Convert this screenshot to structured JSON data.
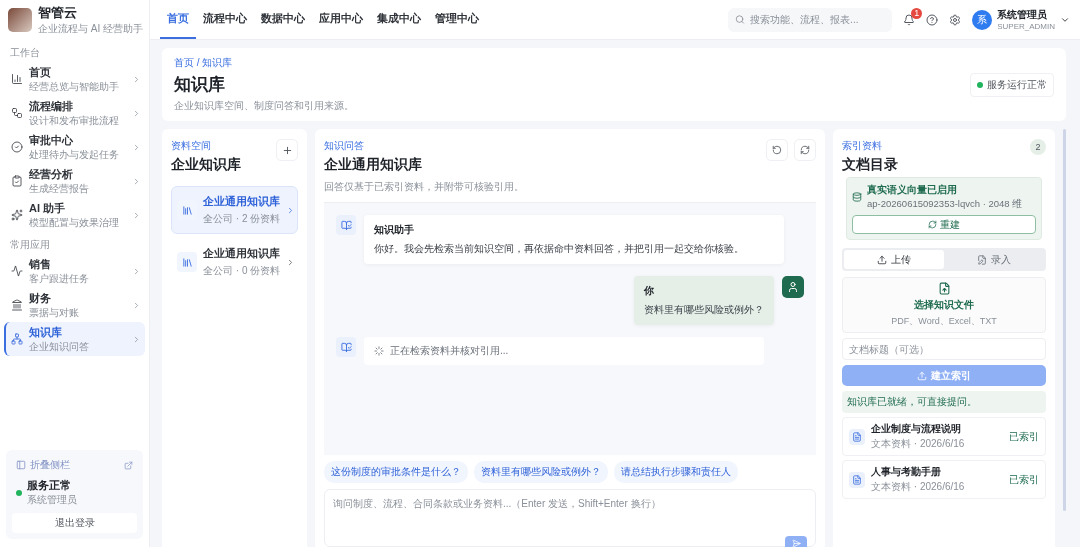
{
  "brand": {
    "name": "智管云",
    "subtitle": "企业流程与 AI 经营助手"
  },
  "sidebar": {
    "sections": [
      {
        "title": "工作台",
        "items": [
          {
            "label": "首页",
            "desc": "经营总览与智能助手",
            "selected": false
          },
          {
            "label": "流程编排",
            "desc": "设计和发布审批流程",
            "selected": false
          },
          {
            "label": "审批中心",
            "desc": "处理待办与发起任务",
            "selected": false
          },
          {
            "label": "经营分析",
            "desc": "生成经营报告",
            "selected": false
          },
          {
            "label": "AI 助手",
            "desc": "模型配置与效果治理",
            "selected": false
          }
        ]
      },
      {
        "title": "常用应用",
        "items": [
          {
            "label": "销售",
            "desc": "客户跟进任务",
            "selected": false
          },
          {
            "label": "财务",
            "desc": "票据与对账",
            "selected": false
          },
          {
            "label": "知识库",
            "desc": "企业知识问答",
            "selected": true
          }
        ]
      }
    ],
    "footer": {
      "collapse": "折叠侧栏",
      "status": "服务正常",
      "role": "系统管理员",
      "logout": "退出登录"
    }
  },
  "topnav": {
    "tabs": [
      {
        "label": "首页",
        "selected": true
      },
      {
        "label": "流程中心",
        "selected": false
      },
      {
        "label": "数据中心",
        "selected": false
      },
      {
        "label": "应用中心",
        "selected": false
      },
      {
        "label": "集成中心",
        "selected": false
      },
      {
        "label": "管理中心",
        "selected": false
      }
    ],
    "search": {
      "placeholder": "搜索功能、流程、报表..."
    },
    "notifications": "1",
    "user": {
      "avatar": "系",
      "name": "系统管理员",
      "role": "SUPER_ADMIN"
    }
  },
  "header": {
    "breadcrumb": "首页 / 知识库",
    "title": "知识库",
    "description": "企业知识库空间、制度问答和引用来源。",
    "status": "服务运行正常"
  },
  "spaces": {
    "eyebrow": "资料空间",
    "title": "企业知识库",
    "items": [
      {
        "name": "企业通用知识库",
        "meta": "全公司 · 2 份资料",
        "selected": true
      },
      {
        "name": "企业通用知识库",
        "meta": "全公司 · 0 份资料",
        "selected": false
      }
    ]
  },
  "chat": {
    "eyebrow": "知识问答",
    "title": "企业通用知识库",
    "description": "回答仅基于已索引资料，并附带可核验引用。",
    "messages": [
      {
        "kind": "assistant",
        "author": "知识助手",
        "text": "你好。我会先检索当前知识空间，再依据命中资料回答，并把引用一起交给你核验。"
      },
      {
        "kind": "user",
        "author": "你",
        "text": "资料里有哪些风险或例外？"
      },
      {
        "kind": "loading",
        "text": "正在检索资料并核对引用..."
      }
    ],
    "suggestions": [
      "这份制度的审批条件是什么？",
      "资料里有哪些风险或例外？",
      "请总结执行步骤和责任人"
    ],
    "input": {
      "placeholder": "询问制度、流程、合同条款或业务资料...（Enter 发送，Shift+Enter 换行）"
    }
  },
  "documents": {
    "eyebrow": "索引资料",
    "title": "文档目录",
    "count": "2",
    "vector": {
      "title": "真实语义向量已启用",
      "detail": "ap-20260615092353-lqvch · 2048 维",
      "rebuild": "重建"
    },
    "tabs": [
      {
        "label": "上传",
        "selected": true
      },
      {
        "label": "录入",
        "selected": false
      }
    ],
    "upload": {
      "title": "选择知识文件",
      "formats": "PDF、Word、Excel、TXT"
    },
    "title_field": {
      "placeholder": "文档标题（可选）"
    },
    "submit": {
      "label": "建立索引",
      "disabled": true
    },
    "notice": "知识库已就绪，可直接提问。",
    "items": [
      {
        "name": "企业制度与流程说明",
        "meta": "文本资料 · 2026/6/16",
        "status": "已索引"
      },
      {
        "name": "人事与考勤手册",
        "meta": "文本资料 · 2026/6/16",
        "status": "已索引"
      }
    ]
  }
}
